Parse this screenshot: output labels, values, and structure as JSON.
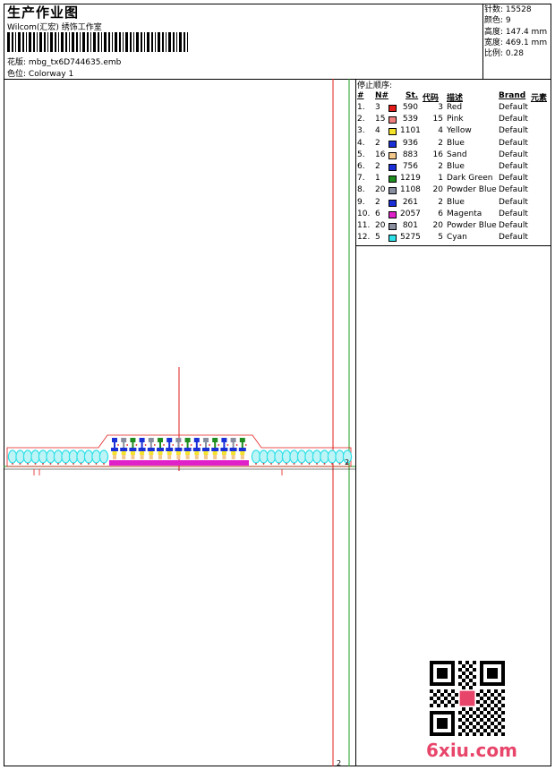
{
  "header": {
    "title": "生产作业图",
    "subtitle": "Wilcom(汇宏) 绣饰工作室",
    "design_label": "花版:",
    "design_file": "mbg_tx6D744635.emb",
    "colorway_label": "色位:",
    "colorway": "Colorway 1"
  },
  "stats": [
    {
      "label": "针数:",
      "value": "15528"
    },
    {
      "label": "颜色:",
      "value": "9"
    },
    {
      "label": "高度:",
      "value": "147.4 mm"
    },
    {
      "label": "宽度:",
      "value": "469.1 mm"
    },
    {
      "label": "比例:",
      "value": "0.28"
    }
  ],
  "sequence": {
    "title": "停止顺序:",
    "columns": [
      "#",
      "N#",
      "St.",
      "代码",
      "描述",
      "Brand",
      "元素"
    ],
    "rows": [
      {
        "idx": "1.",
        "n": "3",
        "st": "590",
        "code": "3",
        "desc": "Red",
        "brand": "Default",
        "color": "#e31b1b"
      },
      {
        "idx": "2.",
        "n": "15",
        "st": "539",
        "code": "15",
        "desc": "Pink",
        "brand": "Default",
        "color": "#f08080"
      },
      {
        "idx": "3.",
        "n": "4",
        "st": "1101",
        "code": "4",
        "desc": "Yellow",
        "brand": "Default",
        "color": "#f5e32a"
      },
      {
        "idx": "4.",
        "n": "2",
        "st": "936",
        "code": "2",
        "desc": "Blue",
        "brand": "Default",
        "color": "#1a2fd6"
      },
      {
        "idx": "5.",
        "n": "16",
        "st": "883",
        "code": "16",
        "desc": "Sand",
        "brand": "Default",
        "color": "#f4c98a"
      },
      {
        "idx": "6.",
        "n": "2",
        "st": "756",
        "code": "2",
        "desc": "Blue",
        "brand": "Default",
        "color": "#1a2fd6"
      },
      {
        "idx": "7.",
        "n": "1",
        "st": "1219",
        "code": "1",
        "desc": "Dark Green",
        "brand": "Default",
        "color": "#1e8c1e"
      },
      {
        "idx": "8.",
        "n": "20",
        "st": "1108",
        "code": "20",
        "desc": "Powder Blue",
        "brand": "Default",
        "color": "#8a8fa0"
      },
      {
        "idx": "9.",
        "n": "2",
        "st": "261",
        "code": "2",
        "desc": "Blue",
        "brand": "Default",
        "color": "#1a2fd6"
      },
      {
        "idx": "10.",
        "n": "6",
        "st": "2057",
        "code": "6",
        "desc": "Magenta",
        "brand": "Default",
        "color": "#e020c8"
      },
      {
        "idx": "11.",
        "n": "20",
        "st": "801",
        "code": "20",
        "desc": "Powder Blue",
        "brand": "Default",
        "color": "#8a8fa0"
      },
      {
        "idx": "12.",
        "n": "5",
        "st": "5275",
        "code": "5",
        "desc": "Cyan",
        "brand": "Default",
        "color": "#2ee0e8"
      }
    ]
  },
  "canvas_marks": {
    "right_mark": "2",
    "bottom_mark": "2"
  },
  "watermark": "6xiu.com"
}
